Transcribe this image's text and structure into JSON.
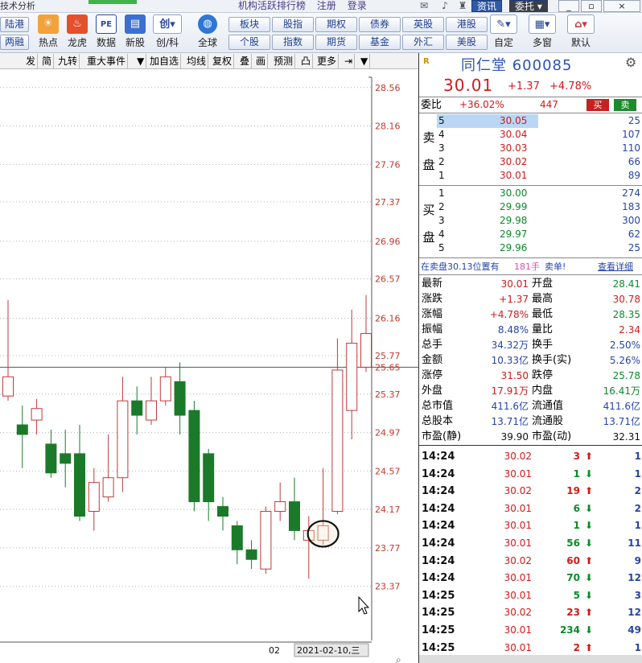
{
  "app": {
    "title": "技术分析",
    "center_links": [
      "机构活跃排行榜",
      "注册",
      "登录"
    ],
    "btn_info": "资讯",
    "btn_entrust": "委托",
    "win_min": "_",
    "win_restore": "▫",
    "win_close": "×"
  },
  "toolbar": {
    "small_left": [
      "陆港",
      "两融"
    ],
    "big": [
      {
        "label": "热点",
        "icon": "hot-icon"
      },
      {
        "label": "龙虎",
        "icon": "dragon-icon"
      },
      {
        "label": "数据",
        "icon": "pe-data-icon"
      },
      {
        "label": "新股",
        "icon": "ipo-icon"
      },
      {
        "label": "创/科",
        "icon": "chuang-icon"
      },
      {
        "label": "全球",
        "icon": "globe-icon"
      }
    ],
    "grid_row1": [
      "板块",
      "股指",
      "期权",
      "债券",
      "英股",
      "港股"
    ],
    "grid_row2": [
      "个股",
      "指数",
      "期货",
      "基金",
      "外汇",
      "美股"
    ],
    "right": [
      {
        "label": "自定",
        "icon": "custom-icon"
      },
      {
        "label": "多窗",
        "icon": "multi-window-icon"
      },
      {
        "label": "默认",
        "icon": "home-icon"
      }
    ],
    "chuang_glyph": "创",
    "pe_glyph": "PE"
  },
  "chart_tabs": [
    "发",
    "简",
    "九转",
    "重大事件",
    "▼",
    "加自选",
    "均线",
    "复权",
    "叠",
    "画",
    "预测",
    "凸",
    "更多",
    "⇥",
    "▼"
  ],
  "chart_data": {
    "type": "candlestick",
    "ylim": [
      23.2,
      28.6
    ],
    "yticks": [
      "28.56",
      "28.16",
      "27.76",
      "27.37",
      "26.96",
      "26.57",
      "26.16",
      "25.77",
      "25.37",
      "24.97",
      "24.57",
      "24.17",
      "23.77",
      "23.37"
    ],
    "current_price_label": "25.65",
    "current_price": 25.65,
    "x_labels": [
      "02",
      "2021-02-10,三"
    ],
    "candles": [
      {
        "o": 25.35,
        "c": 25.55,
        "h": 26.35,
        "l": 25.3
      },
      {
        "o": 25.05,
        "c": 24.95,
        "h": 25.25,
        "l": 24.6
      },
      {
        "o": 25.1,
        "c": 25.22,
        "h": 25.32,
        "l": 24.95
      },
      {
        "o": 24.85,
        "c": 24.55,
        "h": 25.0,
        "l": 24.5
      },
      {
        "o": 24.75,
        "c": 24.65,
        "h": 25.0,
        "l": 24.4
      },
      {
        "o": 24.75,
        "c": 24.1,
        "h": 25.05,
        "l": 24.05
      },
      {
        "o": 24.15,
        "c": 24.45,
        "h": 24.6,
        "l": 23.95
      },
      {
        "o": 24.3,
        "c": 24.5,
        "h": 24.95,
        "l": 24.25
      },
      {
        "o": 24.5,
        "c": 25.3,
        "h": 25.55,
        "l": 24.35
      },
      {
        "o": 25.3,
        "c": 25.15,
        "h": 25.45,
        "l": 24.95
      },
      {
        "o": 25.1,
        "c": 25.3,
        "h": 25.55,
        "l": 25.05
      },
      {
        "o": 25.3,
        "c": 25.55,
        "h": 25.65,
        "l": 25.25
      },
      {
        "o": 25.5,
        "c": 25.15,
        "h": 25.7,
        "l": 24.95
      },
      {
        "o": 25.2,
        "c": 24.25,
        "h": 25.3,
        "l": 24.15
      },
      {
        "o": 24.75,
        "c": 24.25,
        "h": 24.8,
        "l": 24.05
      },
      {
        "o": 24.2,
        "c": 24.1,
        "h": 24.3,
        "l": 23.95
      },
      {
        "o": 24.0,
        "c": 23.75,
        "h": 24.05,
        "l": 23.6
      },
      {
        "o": 23.75,
        "c": 23.65,
        "h": 23.85,
        "l": 23.55
      },
      {
        "o": 23.55,
        "c": 24.15,
        "h": 24.2,
        "l": 23.5
      },
      {
        "o": 24.15,
        "c": 24.25,
        "h": 24.45,
        "l": 24.05
      },
      {
        "o": 24.25,
        "c": 23.95,
        "h": 24.5,
        "l": 23.85
      },
      {
        "o": 23.85,
        "c": 23.95,
        "h": 24.1,
        "l": 23.45
      },
      {
        "o": 23.85,
        "c": 24.0,
        "h": 24.6,
        "l": 23.8
      },
      {
        "o": 24.15,
        "c": 25.62,
        "h": 25.95,
        "l": 24.12
      },
      {
        "o": 25.2,
        "c": 25.9,
        "h": 26.25,
        "l": 24.9
      },
      {
        "o": 25.65,
        "c": 26.0,
        "h": 26.4,
        "l": 25.6
      }
    ]
  },
  "stock": {
    "badge": "R",
    "name_code": "同仁堂 600085",
    "price": "30.01",
    "change": "+1.37",
    "change_pct": "+4.78%"
  },
  "order_book": {
    "weibi_label": "委比",
    "weibi_pct": "+36.02%",
    "weibi_diff": "447",
    "buy_btn": "买",
    "sell_btn": "卖",
    "sell_side": [
      "卖",
      "盘"
    ],
    "buy_side": [
      "买",
      "盘"
    ],
    "asks": [
      {
        "lvl": "5",
        "price": "30.05",
        "vol": "25"
      },
      {
        "lvl": "4",
        "price": "30.04",
        "vol": "107"
      },
      {
        "lvl": "3",
        "price": "30.03",
        "vol": "110"
      },
      {
        "lvl": "2",
        "price": "30.02",
        "vol": "66"
      },
      {
        "lvl": "1",
        "price": "30.01",
        "vol": "89"
      }
    ],
    "bids": [
      {
        "lvl": "1",
        "price": "30.00",
        "vol": "274"
      },
      {
        "lvl": "2",
        "price": "29.99",
        "vol": "183"
      },
      {
        "lvl": "3",
        "price": "29.98",
        "vol": "300"
      },
      {
        "lvl": "4",
        "price": "29.97",
        "vol": "62"
      },
      {
        "lvl": "5",
        "price": "29.96",
        "vol": "25"
      }
    ],
    "notice_a": "在卖盘30.13位置有",
    "notice_b": "181手",
    "notice_c": "卖单!",
    "notice_link": "查看详细"
  },
  "stats": [
    {
      "l1": "最新",
      "v1": "30.01",
      "c1": "red",
      "l2": "开盘",
      "v2": "28.41",
      "c2": "green"
    },
    {
      "l1": "涨跌",
      "v1": "+1.37",
      "c1": "red",
      "l2": "最高",
      "v2": "30.78",
      "c2": "red"
    },
    {
      "l1": "涨幅",
      "v1": "+4.78%",
      "c1": "red",
      "l2": "最低",
      "v2": "28.35",
      "c2": "green"
    },
    {
      "l1": "振幅",
      "v1": "8.48%",
      "c1": "blue",
      "l2": "量比",
      "v2": "2.34",
      "c2": "red"
    },
    {
      "l1": "总手",
      "v1": "34.32万",
      "c1": "blue",
      "l2": "换手",
      "v2": "2.50%",
      "c2": "blue"
    },
    {
      "l1": "金额",
      "v1": "10.33亿",
      "c1": "blue",
      "l2": "换手(实)",
      "v2": "5.26%",
      "c2": "blue"
    },
    {
      "l1": "涨停",
      "v1": "31.50",
      "c1": "red",
      "l2": "跌停",
      "v2": "25.78",
      "c2": "green"
    },
    {
      "l1": "外盘",
      "v1": "17.91万",
      "c1": "red",
      "l2": "内盘",
      "v2": "16.41万",
      "c2": "green"
    },
    {
      "l1": "总市值",
      "v1": "411.6亿",
      "c1": "blue",
      "l2": "流通值",
      "v2": "411.6亿",
      "c2": "blue"
    },
    {
      "l1": "总股本",
      "v1": "13.71亿",
      "c1": "blue",
      "l2": "流通股",
      "v2": "13.71亿",
      "c2": "blue"
    },
    {
      "l1": "市盈(静)",
      "v1": "39.90",
      "c1": "dark",
      "l2": "市盈(动)",
      "v2": "32.31",
      "c2": "dark"
    }
  ],
  "ticks": [
    {
      "t": "14:24",
      "p": "30.02",
      "pc": "red",
      "v": "3",
      "dir": "up",
      "n": "1"
    },
    {
      "t": "14:24",
      "p": "30.01",
      "pc": "red",
      "v": "1",
      "dir": "down",
      "n": "1"
    },
    {
      "t": "14:24",
      "p": "30.02",
      "pc": "red",
      "v": "19",
      "dir": "up",
      "n": "2"
    },
    {
      "t": "14:24",
      "p": "30.01",
      "pc": "red",
      "v": "6",
      "dir": "down",
      "n": "2"
    },
    {
      "t": "14:24",
      "p": "30.01",
      "pc": "red",
      "v": "1",
      "dir": "down",
      "n": "1"
    },
    {
      "t": "14:24",
      "p": "30.01",
      "pc": "red",
      "v": "56",
      "dir": "down",
      "n": "11"
    },
    {
      "t": "14:24",
      "p": "30.02",
      "pc": "red",
      "v": "60",
      "dir": "up",
      "n": "9"
    },
    {
      "t": "14:24",
      "p": "30.01",
      "pc": "red",
      "v": "70",
      "dir": "down",
      "n": "12"
    },
    {
      "t": "14:25",
      "p": "30.01",
      "pc": "red",
      "v": "5",
      "dir": "down",
      "n": "3"
    },
    {
      "t": "14:25",
      "p": "30.02",
      "pc": "red",
      "v": "23",
      "dir": "up",
      "n": "12"
    },
    {
      "t": "14:25",
      "p": "30.01",
      "pc": "red",
      "v": "234",
      "dir": "down",
      "n": "49"
    },
    {
      "t": "14:25",
      "p": "30.01",
      "pc": "red",
      "v": "2",
      "dir": "up",
      "n": "1"
    }
  ],
  "colors": {
    "up": "#d11a1a",
    "down": "#0a8a2a",
    "candle_up_fill": "#ffffff",
    "candle_up_stroke": "#c23a3a",
    "candle_down_fill": "#1a7a2a",
    "axis_text": "#c0392b",
    "grid": "#b0b0b0"
  }
}
